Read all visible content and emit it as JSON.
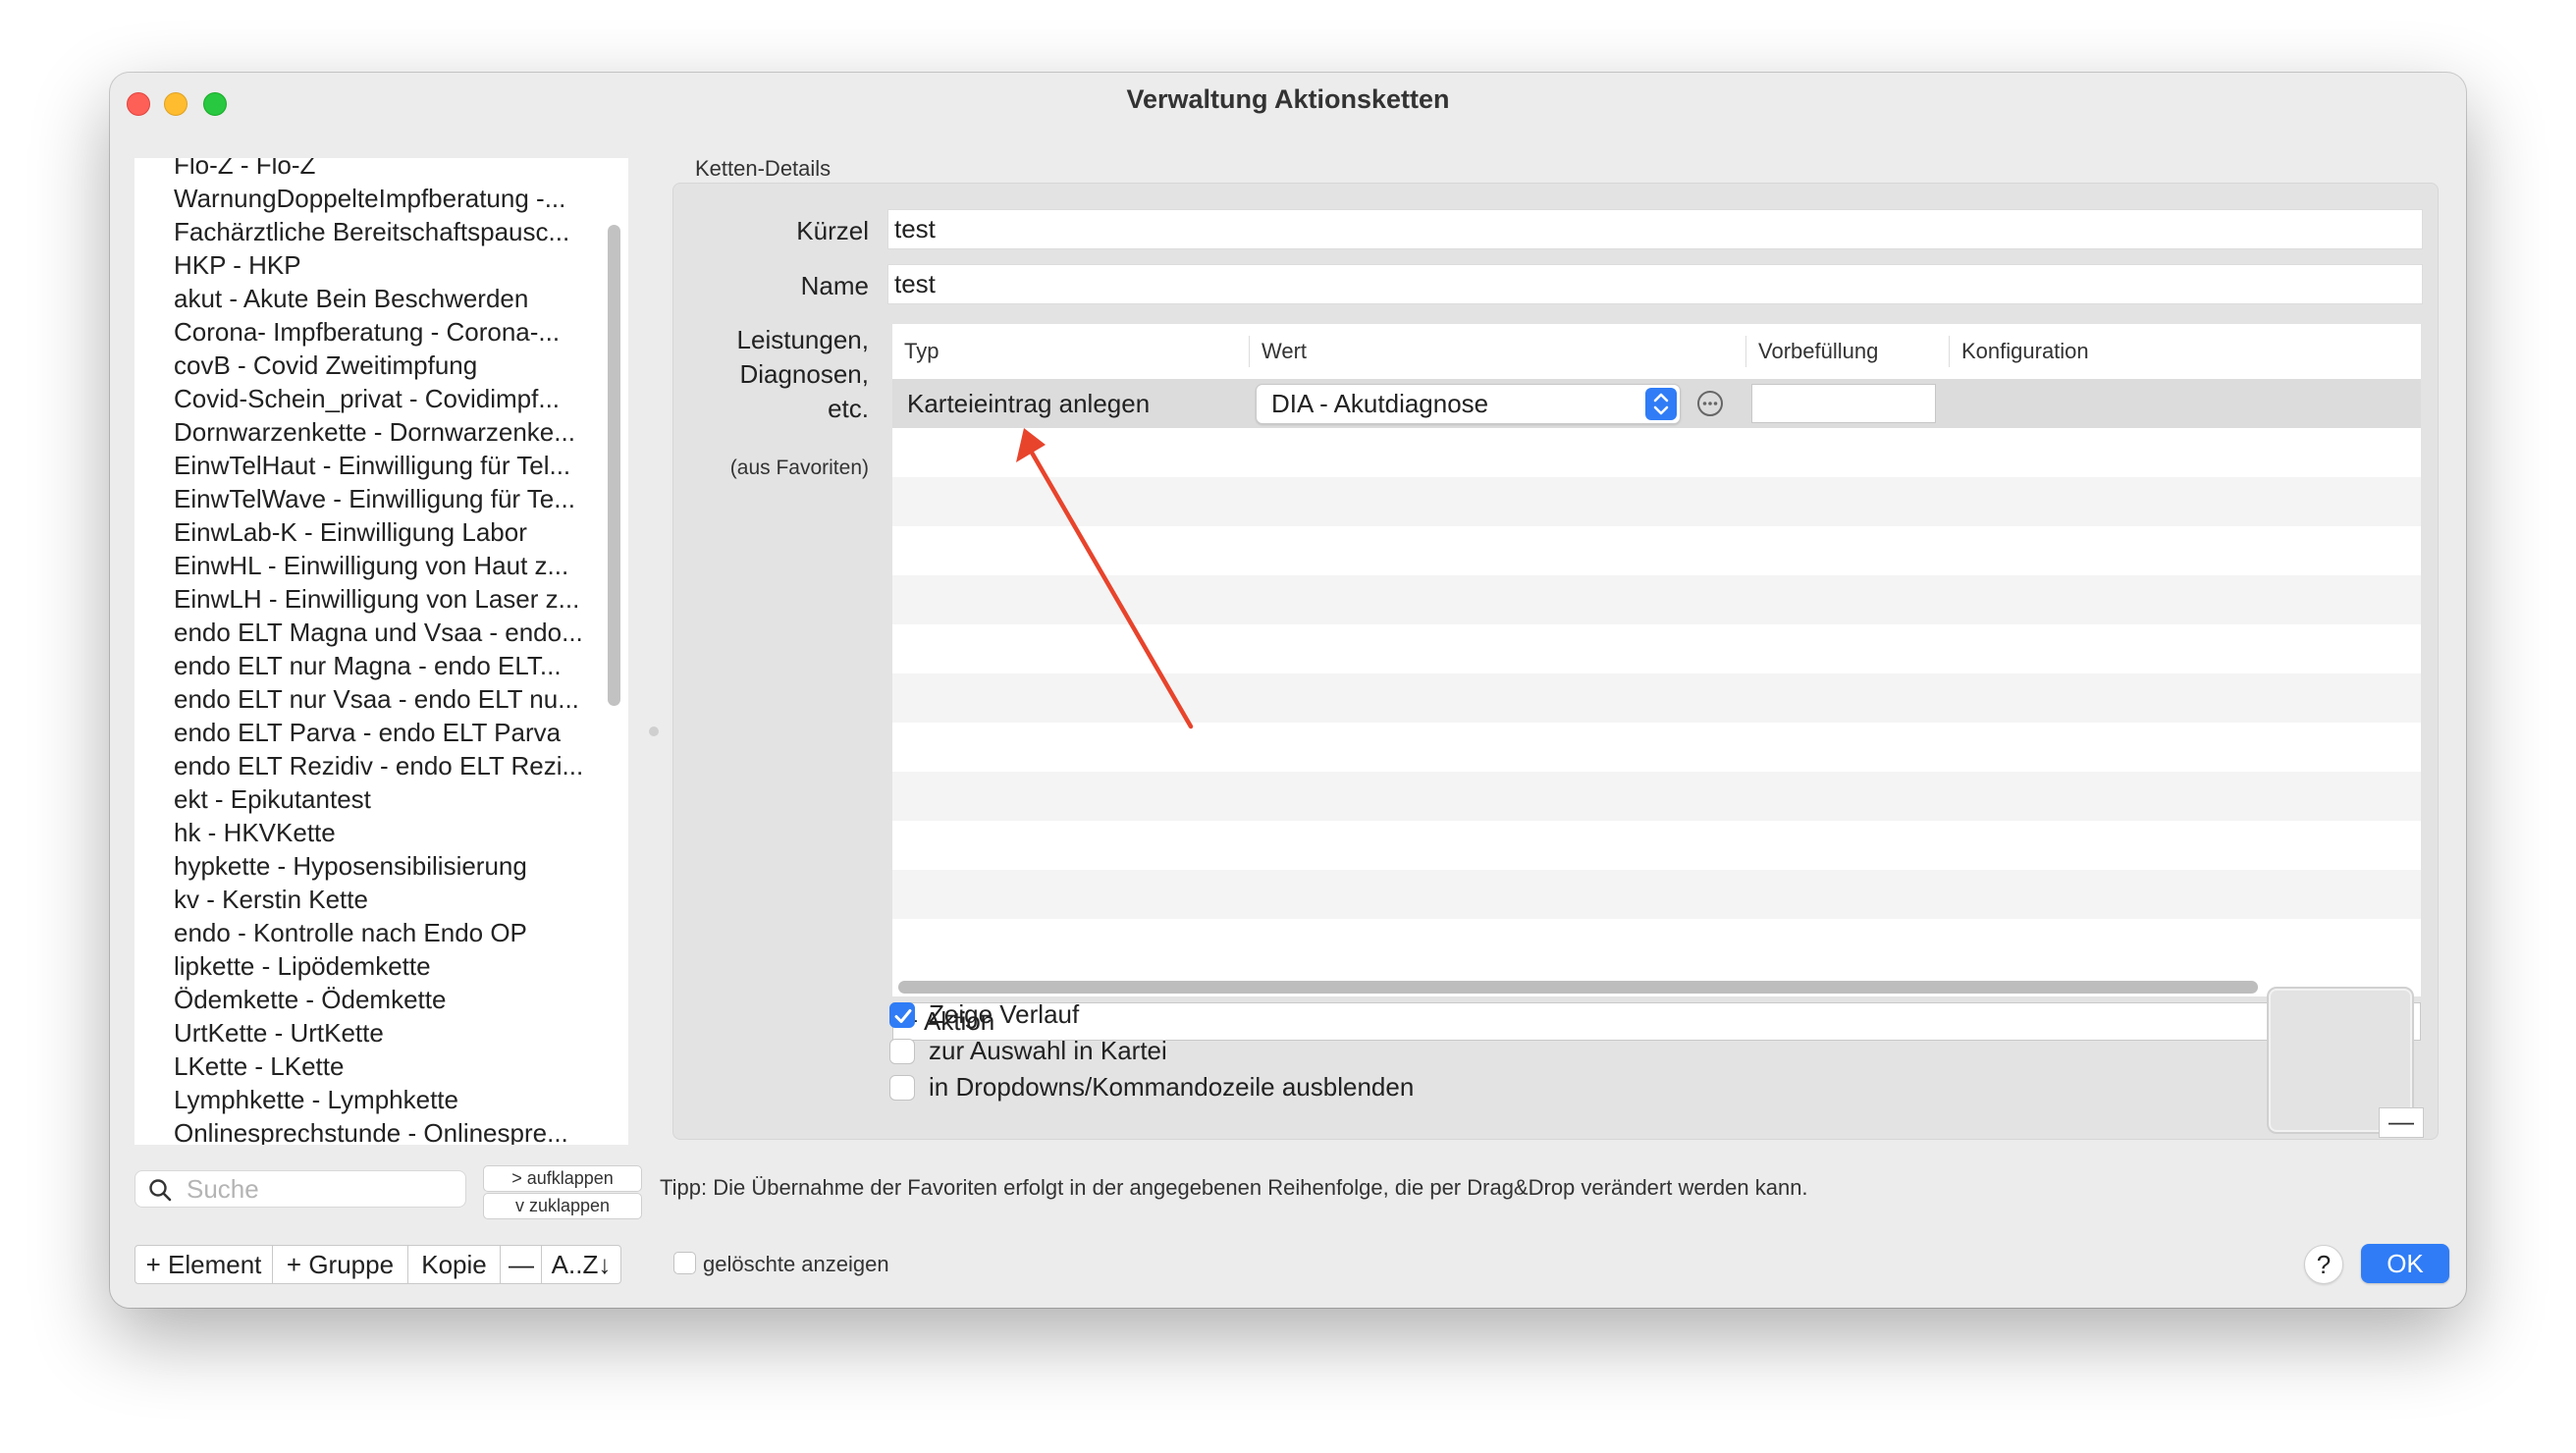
{
  "window": {
    "title": "Verwaltung Aktionsketten"
  },
  "left_list": {
    "items": [
      "Flo-Z - Flo-Z",
      "WarnungDoppelteImpfberatung -...",
      "Fachärztliche Bereitschaftspausc...",
      "HKP - HKP",
      "akut - Akute Bein Beschwerden",
      "Corona- Impfberatung  - Corona-...",
      "covB - Covid Zweitimpfung",
      "Covid-Schein_privat - Covidimpf...",
      "Dornwarzenkette - Dornwarzenke...",
      "EinwTelHaut - Einwilligung für Tel...",
      "EinwTelWave - Einwilligung für Te...",
      "EinwLab-K - Einwilligung Labor",
      "EinwHL - Einwilligung von Haut z...",
      "EinwLH - Einwilligung von Laser z...",
      "endo ELT Magna und Vsaa - endo...",
      "endo ELT nur Magna - endo ELT...",
      "endo ELT nur Vsaa - endo ELT nu...",
      "endo ELT Parva - endo ELT Parva",
      "endo ELT Rezidiv - endo ELT Rezi...",
      "ekt - Epikutantest",
      "hk - HKVKette",
      "hypkette - Hyposensibilisierung",
      "kv - Kerstin Kette",
      "endo - Kontrolle nach Endo OP",
      "lipkette - Lipödemkette",
      "Ödemkette - Ödemkette",
      "UrtKette - UrtKette",
      "LKette - LKette",
      "Lymphkette - Lymphkette",
      "Onlinesprechstunde - Onlinespre..."
    ]
  },
  "search": {
    "placeholder": "Suche",
    "value": ""
  },
  "expand": {
    "aufklappen": "> aufklappen",
    "zuklappen": "v  zuklappen"
  },
  "toolbar": {
    "element": "+ Element",
    "gruppe": "+ Gruppe",
    "kopie": "Kopie",
    "minus": "—",
    "sort": "A..Z↓"
  },
  "show_deleted": {
    "label": "gelöschte anzeigen",
    "checked": false
  },
  "details": {
    "group_title": "Ketten-Details",
    "kuerzel_label": "Kürzel",
    "kuerzel_value": "test",
    "name_label": "Name",
    "name_value": "test",
    "leistungen_line1": "Leistungen,",
    "leistungen_line2": "Diagnosen,",
    "leistungen_line3": "etc.",
    "favoriten_label": "(aus Favoriten)"
  },
  "table": {
    "headers": [
      "Typ",
      "Wert",
      "Vorbefüllung",
      "Konfiguration"
    ],
    "rows": [
      {
        "typ": "Karteieintrag anlegen",
        "wert": "DIA - Akutdiagnose",
        "vorbefuellung": ""
      }
    ]
  },
  "aktion": {
    "add_label": "+ Aktion",
    "remove_label": "—"
  },
  "options": {
    "zeige_verlauf": {
      "label": "Zeige Verlauf",
      "checked": true
    },
    "zur_auswahl": {
      "label": "zur Auswahl in Kartei",
      "checked": false
    },
    "ausblenden": {
      "label": "in Dropdowns/Kommandozeile ausblenden",
      "checked": false
    }
  },
  "image_well": {
    "remove_label": "—"
  },
  "tip": "Tipp: Die Übernahme der Favoriten erfolgt in der angegebenen Reihenfolge, die per Drag&Drop verändert werden kann.",
  "footer": {
    "help": "?",
    "ok": "OK"
  },
  "colors": {
    "accent": "#2f7cf6",
    "annotation": "#e8442c"
  }
}
